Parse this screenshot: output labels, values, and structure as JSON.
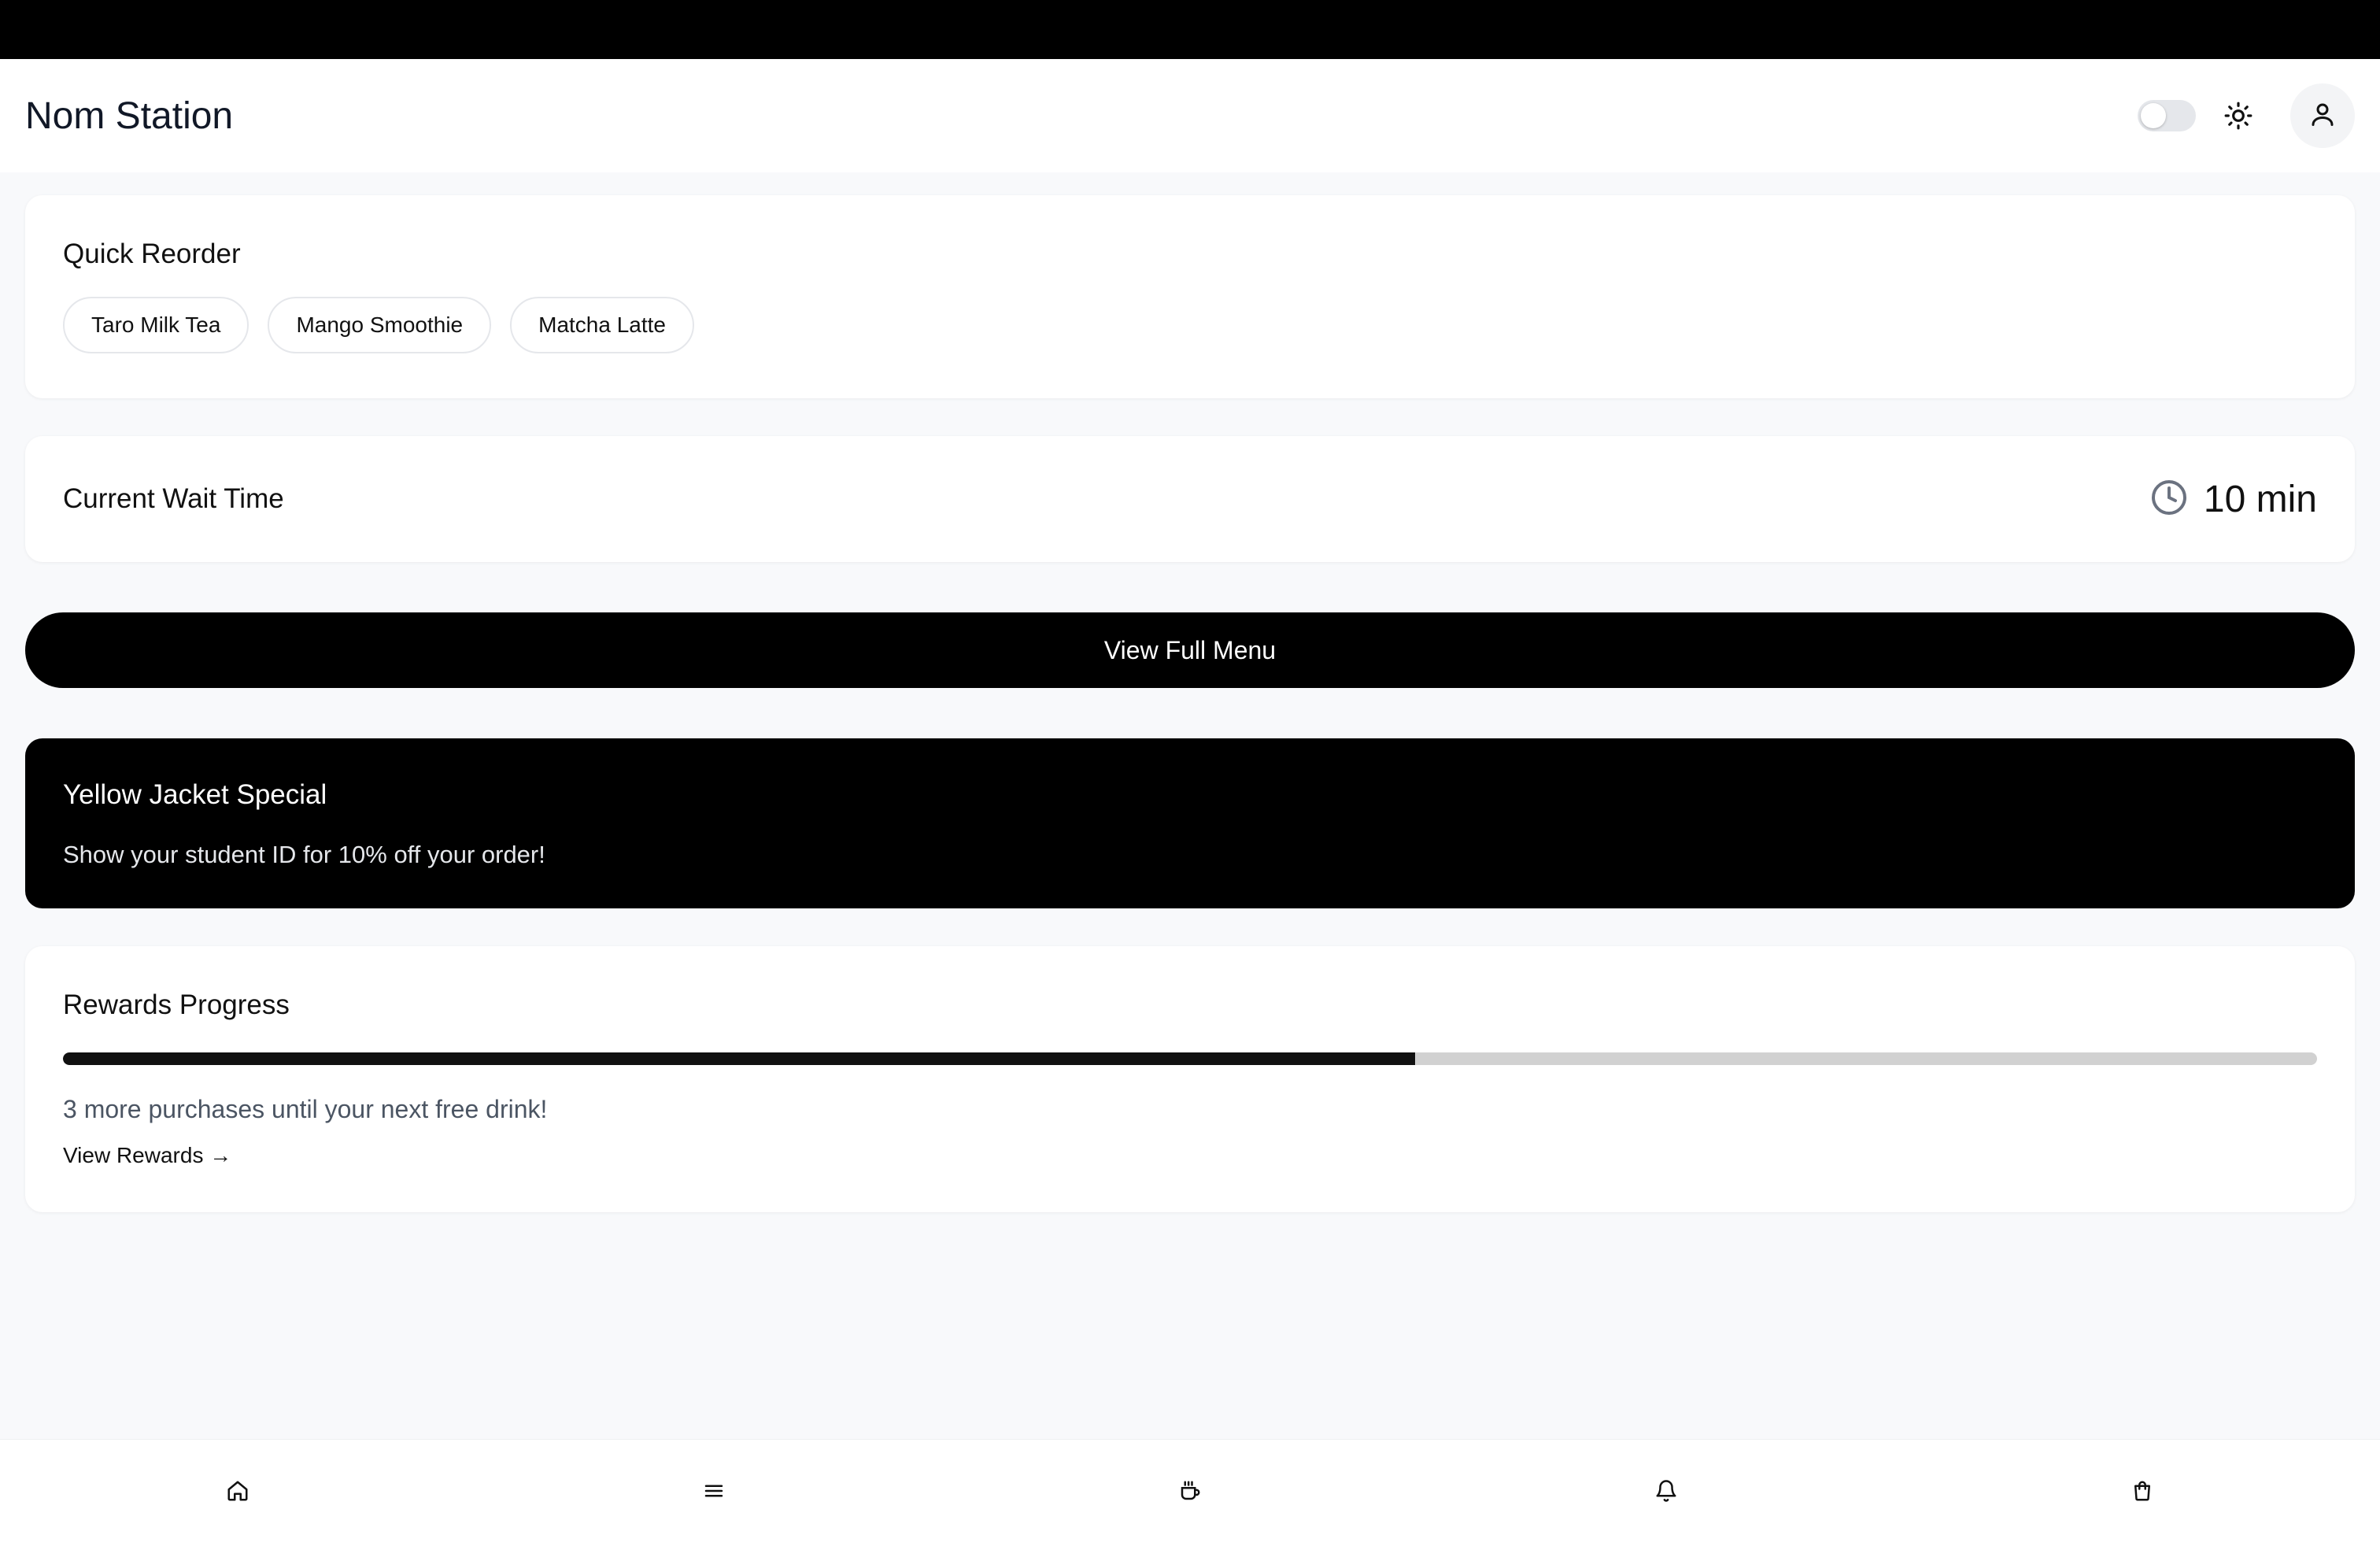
{
  "header": {
    "title": "Nom Station",
    "toggle_icon": "toggle-switch-icon",
    "theme_icon": "sun-icon",
    "profile_icon": "user-icon"
  },
  "quick_reorder": {
    "title": "Quick Reorder",
    "items": [
      "Taro Milk Tea",
      "Mango Smoothie",
      "Matcha Latte"
    ]
  },
  "wait_time": {
    "label": "Current Wait Time",
    "icon": "clock-icon",
    "value": "10 min"
  },
  "menu_button": {
    "label": "View Full Menu"
  },
  "special": {
    "title": "Yellow Jacket Special",
    "text": "Show your student ID for 10% off your order!"
  },
  "rewards": {
    "title": "Rewards Progress",
    "progress_percent": 60,
    "message": "3 more purchases until your next free drink!",
    "link_label": "View Rewards →"
  },
  "bottom_nav": {
    "items": [
      "home-icon",
      "menu-icon",
      "coffee-icon",
      "bell-icon",
      "shopping-bag-icon"
    ]
  }
}
